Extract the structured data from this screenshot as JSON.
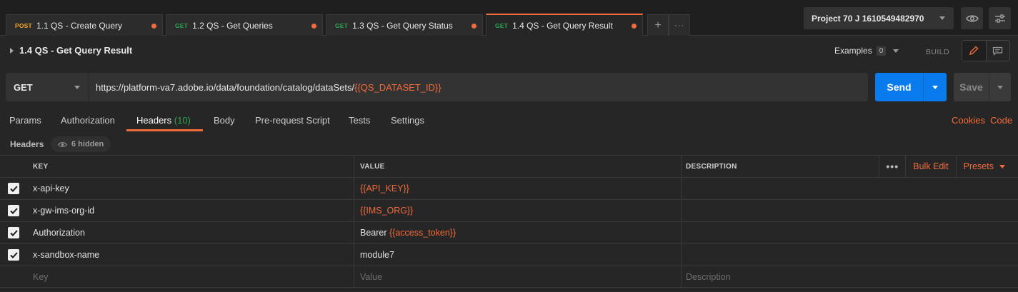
{
  "tabs": [
    {
      "method": "POST",
      "name": "1.1 QS - Create Query",
      "unsaved": true
    },
    {
      "method": "GET",
      "name": "1.2 QS - Get Queries",
      "unsaved": true
    },
    {
      "method": "GET",
      "name": "1.3 QS - Get Query Status",
      "unsaved": true
    },
    {
      "method": "GET",
      "name": "1.4 QS - Get Query Result",
      "unsaved": true,
      "active": true
    }
  ],
  "tab_actions": {
    "add_icon": "+",
    "more_icon": "···"
  },
  "environment": {
    "selected": "Project 70 J 1610549482970"
  },
  "request": {
    "title": "1.4 QS - Get Query Result",
    "examples_label": "Examples",
    "examples_count": "0",
    "build_label": "BUILD",
    "method": "GET",
    "url_base": "https://platform-va7.adobe.io/data/foundation/catalog/dataSets/",
    "url_var": "{{QS_DATASET_ID}}",
    "send_label": "Send",
    "save_label": "Save"
  },
  "request_tabs": {
    "params": "Params",
    "authorization": "Authorization",
    "headers": "Headers",
    "headers_count": "(10)",
    "body": "Body",
    "prerequest": "Pre-request Script",
    "tests": "Tests",
    "settings": "Settings",
    "cookies": "Cookies",
    "code": "Code"
  },
  "headers_section": {
    "label": "Headers",
    "hidden_label": "6 hidden",
    "columns": {
      "key": "KEY",
      "value": "VALUE",
      "description": "DESCRIPTION"
    },
    "bulk_edit": "Bulk Edit",
    "presets": "Presets",
    "rows": [
      {
        "key": "x-api-key",
        "value_prefix": "",
        "value_var": "{{API_KEY}}",
        "checked": true
      },
      {
        "key": "x-gw-ims-org-id",
        "value_prefix": "",
        "value_var": "{{IMS_ORG}}",
        "checked": true
      },
      {
        "key": "Authorization",
        "value_prefix": "Bearer ",
        "value_var": "{{access_token}}",
        "checked": true
      },
      {
        "key": "x-sandbox-name",
        "value_prefix": "module7",
        "value_var": "",
        "checked": true
      }
    ],
    "placeholders": {
      "key": "Key",
      "value": "Value",
      "description": "Description"
    }
  },
  "colors": {
    "accent": "#f26b3a",
    "send": "#097bed",
    "get": "#2fa44f",
    "post": "#f5a623"
  }
}
